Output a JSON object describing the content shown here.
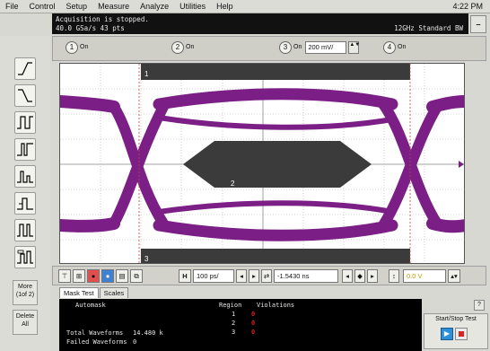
{
  "menu": {
    "items": [
      "File",
      "Control",
      "Setup",
      "Measure",
      "Analyze",
      "Utilities",
      "Help"
    ],
    "time": "4:22 PM"
  },
  "status": {
    "line1": "Acquisition is stopped.",
    "line2": "40.0 GSa/s    43 pts",
    "right": "12GHz Standard BW"
  },
  "channels": [
    {
      "num": "1",
      "state": "On"
    },
    {
      "num": "2",
      "state": "On"
    },
    {
      "num": "3",
      "state": "On",
      "scale": "200 mV/"
    },
    {
      "num": "4",
      "state": "On"
    }
  ],
  "side": {
    "more": "More\n(1of 2)",
    "delete": "Delete\nAll"
  },
  "display": {
    "region_labels": [
      "1",
      "2",
      "3"
    ],
    "trace_color": "#7b1f86",
    "mask_color": "#3b3b3b"
  },
  "control": {
    "h_label": "H",
    "timebase": "100 ps/",
    "delay": "-1.5430 ns",
    "trig_level": "0.0 V"
  },
  "tabs": [
    "Mask Test",
    "Scales"
  ],
  "mask_test": {
    "automask": "Automask",
    "region_header": "Region",
    "violations_header": "Violations",
    "regions": [
      "1",
      "2",
      "3"
    ],
    "violations": [
      "0",
      "0",
      "0"
    ],
    "total_label": "Total Waveforms",
    "total_value": "14.480 k",
    "failed_label": "Failed Waveforms",
    "failed_value": "0"
  },
  "start_stop": {
    "label": "Start/Stop Test"
  }
}
